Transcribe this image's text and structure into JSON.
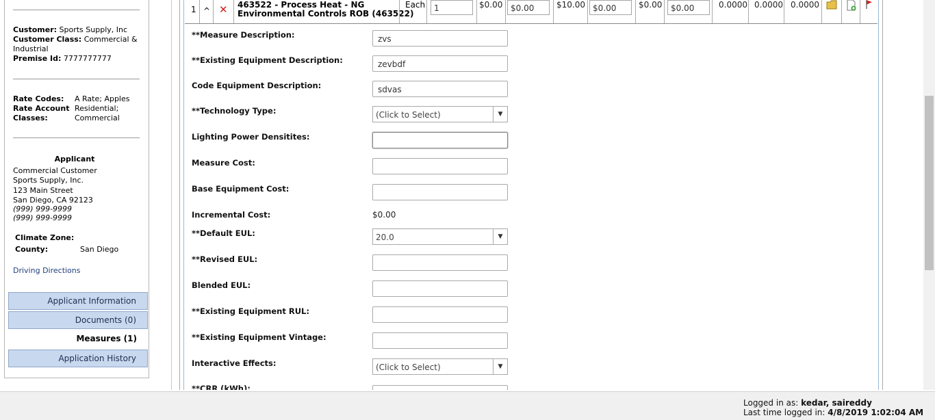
{
  "customer": {
    "customer_label": "Customer:",
    "customer_value": "Sports Supply, Inc",
    "class_label": "Customer Class:",
    "class_value_1": "Commercial &",
    "class_value_2": "Industrial",
    "premise_label": "Premise Id:",
    "premise_value": "7777777777"
  },
  "rates": {
    "codes_label": "Rate Codes:",
    "codes_value": "A Rate; Apples",
    "account_label": "Rate Account",
    "classes_label": "Classes:",
    "account_value_1": "Residential;",
    "account_value_2": "Commercial"
  },
  "applicant": {
    "heading": "Applicant",
    "lines": [
      "Commercial Customer",
      "Sports Supply, Inc.",
      "123 Main Street",
      "San Diego, CA 92123"
    ],
    "phones": [
      "(999) 999-9999",
      "(999) 999-9999"
    ]
  },
  "climate": {
    "zone_label": "Climate Zone:",
    "county_label": "County:",
    "county_value": "San Diego"
  },
  "driving_directions": "Driving Directions",
  "nav": [
    {
      "label": "Applicant Information"
    },
    {
      "label": "Documents (0)"
    },
    {
      "label": "Measures (1)"
    },
    {
      "label": "Application History"
    }
  ],
  "measure_row": {
    "index": "1",
    "up_glyph": "^",
    "delete_glyph": "✕",
    "title_1": "463522 - Process Heat - NG",
    "title_2": "Environmental Controls ROB (463522)",
    "unit": "Each",
    "quantity": "1",
    "price_1": "$0.00",
    "price_1_input": "$0.00",
    "price_2": "$10.00",
    "price_2_input": "$0.00",
    "price_3": "$0.00",
    "price_3_input": "$0.00",
    "num_1": "0.0000",
    "num_2": "0.0000",
    "num_3": "0.0000"
  },
  "fields": [
    {
      "label": "**Measure Description:",
      "value": "zvs"
    },
    {
      "label": "**Existing Equipment Description:",
      "value": "zevbdf"
    },
    {
      "label": "Code Equipment Description:",
      "value": "sdvas"
    },
    {
      "label": "**Technology Type:",
      "value": "(Click to Select)"
    },
    {
      "label": "Lighting Power Densitites:",
      "value": ""
    },
    {
      "label": "Measure Cost:",
      "value": ""
    },
    {
      "label": "Base Equipment Cost:",
      "value": ""
    },
    {
      "label": "Incremental Cost:",
      "value": "$0.00"
    },
    {
      "label": "**Default EUL:",
      "value": "20.0"
    },
    {
      "label": "**Revised EUL:",
      "value": ""
    },
    {
      "label": "Blended EUL:",
      "value": ""
    },
    {
      "label": "**Existing Equipment RUL:",
      "value": ""
    },
    {
      "label": "**Existing Equipment Vintage:",
      "value": ""
    },
    {
      "label": "Interactive Effects:",
      "value": "(Click to Select)"
    },
    {
      "label": "**CRR (kWh):",
      "value": ""
    }
  ],
  "footer": {
    "logged_label": "Logged in as:",
    "logged_user": "kedar, saireddy",
    "last_label": "Last time logged in:",
    "last_value": "4/8/2019 1:02:04 AM"
  }
}
